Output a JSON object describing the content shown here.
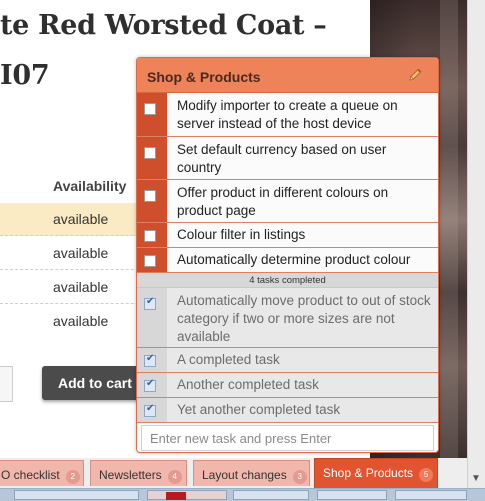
{
  "product": {
    "title_line1": "te Red Worsted Coat –",
    "title_line2": "I07",
    "availability_header": "Availability",
    "availability_rows": [
      "available",
      "available",
      "available",
      "available"
    ],
    "add_to_cart_label": "Add to cart"
  },
  "popup": {
    "title": "Shop & Products",
    "edit_icon": "pencil-icon",
    "open_tasks": [
      "Modify importer to create a queue on server instead of the host device",
      "Set default currency based on user country",
      "Offer product in different colours on product page",
      "Colour filter in listings",
      "Automatically determine product colour"
    ],
    "completed_summary": "4 tasks completed",
    "completed_tasks": [
      "Automatically move product to out of stock category if two or more sizes are not available",
      "A completed task",
      "Another completed task",
      "Yet another completed task"
    ],
    "new_task_placeholder": "Enter new task and press Enter"
  },
  "tabs": [
    {
      "label": "O checklist",
      "count": "2"
    },
    {
      "label": "Newsletters",
      "count": "4"
    },
    {
      "label": "Layout changes",
      "count": "3"
    },
    {
      "label": "Shop & Products",
      "count": "5"
    }
  ],
  "colors": {
    "accent": "#e2532f",
    "popup_header": "#ee8259",
    "open_task_strip": "#cf4f2c",
    "inactive_tab": "#f1b7ac"
  }
}
